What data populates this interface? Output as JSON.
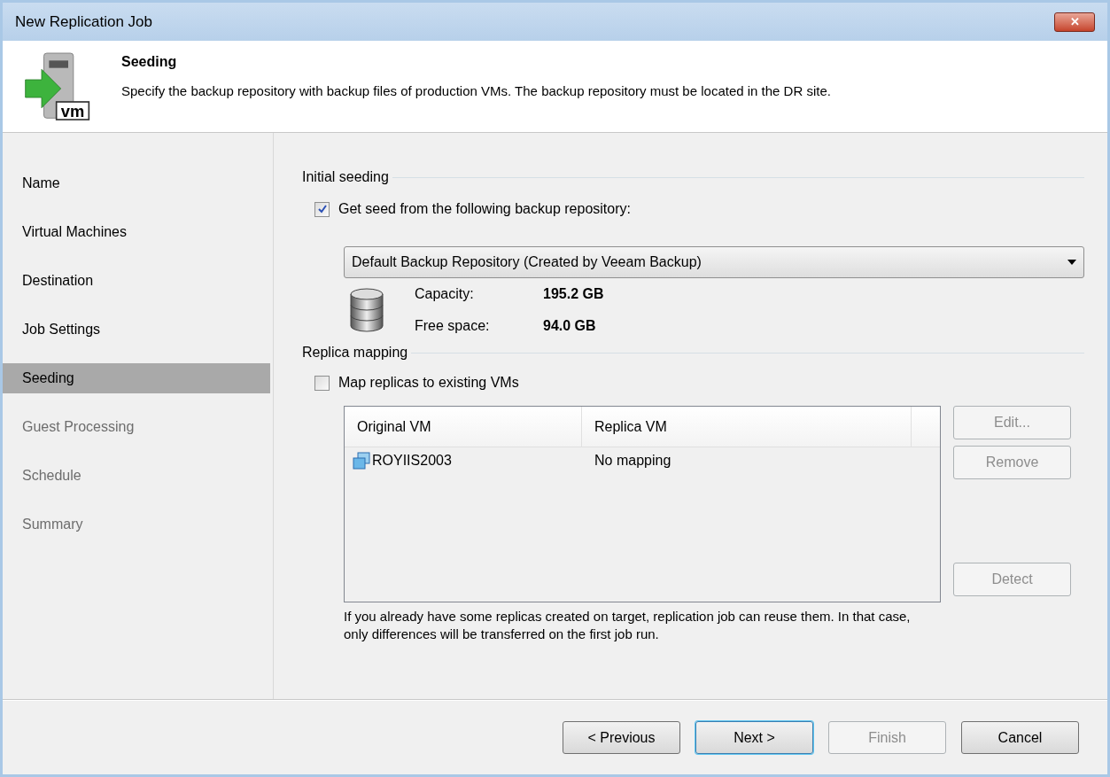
{
  "window": {
    "title": "New Replication Job",
    "close": "✕"
  },
  "header": {
    "title": "Seeding",
    "description": "Specify the backup repository with backup files of production VMs. The backup repository must be located in the DR site.",
    "icon_text": "vm"
  },
  "sidebar": {
    "items": [
      {
        "label": "Name",
        "selected": false,
        "disabled": false
      },
      {
        "label": "Virtual Machines",
        "selected": false,
        "disabled": false
      },
      {
        "label": "Destination",
        "selected": false,
        "disabled": false
      },
      {
        "label": "Job Settings",
        "selected": false,
        "disabled": false
      },
      {
        "label": "Seeding",
        "selected": true,
        "disabled": false
      },
      {
        "label": "Guest Processing",
        "selected": false,
        "disabled": true
      },
      {
        "label": "Schedule",
        "selected": false,
        "disabled": true
      },
      {
        "label": "Summary",
        "selected": false,
        "disabled": true
      }
    ]
  },
  "initial_seeding": {
    "heading": "Initial seeding",
    "checkbox": {
      "label": "Get seed from the following backup repository:",
      "checked": true
    },
    "repository": {
      "value": "Default Backup Repository (Created by Veeam Backup)"
    },
    "stats": [
      {
        "label": "Capacity:",
        "value": "195.2 GB"
      },
      {
        "label": "Free space:",
        "value": "94.0 GB"
      }
    ]
  },
  "replica_mapping": {
    "heading": "Replica mapping",
    "checkbox": {
      "label": "Map replicas to existing VMs",
      "checked": false
    },
    "table": {
      "columns": [
        "Original VM",
        "Replica VM"
      ],
      "rows": [
        [
          "ROYIIS2003",
          "No mapping"
        ]
      ]
    },
    "buttons": [
      {
        "label": "Edit...",
        "disabled": true
      },
      {
        "label": "Remove",
        "disabled": true
      },
      {
        "label": "Detect",
        "disabled": true
      }
    ],
    "note": "If you already have some replicas created on target, replication job can reuse them. In that case, only differences will be transferred on the first job run."
  },
  "footer": {
    "buttons": [
      {
        "label": "< Previous",
        "disabled": false,
        "default": false
      },
      {
        "label": "Next >",
        "disabled": false,
        "default": true
      },
      {
        "label": "Finish",
        "disabled": true,
        "default": false
      },
      {
        "label": "Cancel",
        "disabled": false,
        "default": false
      }
    ]
  }
}
